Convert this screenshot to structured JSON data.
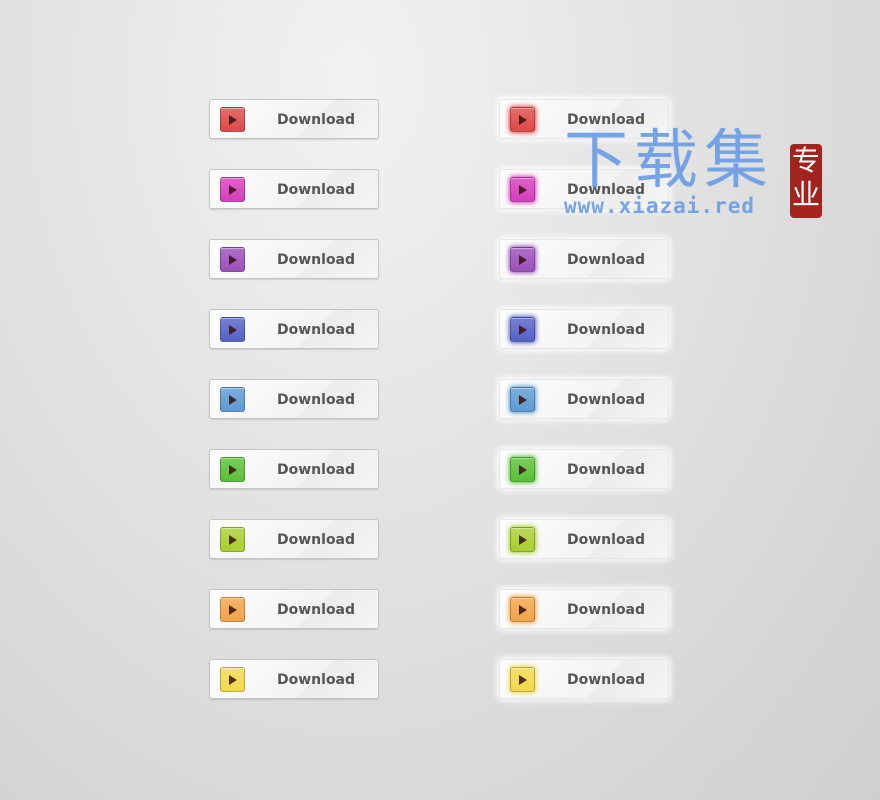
{
  "buttons": {
    "label": "Download",
    "icon": "play-icon",
    "colors": [
      "#e04848",
      "#d53dbd",
      "#9b4fbb",
      "#5461c6",
      "#5e9ad2",
      "#5bbf38",
      "#a9cf2e",
      "#f2a447",
      "#f2d94a"
    ]
  },
  "watermark": {
    "chinese": "下载集",
    "url": "www.xiazai.red",
    "seal": "专业"
  }
}
